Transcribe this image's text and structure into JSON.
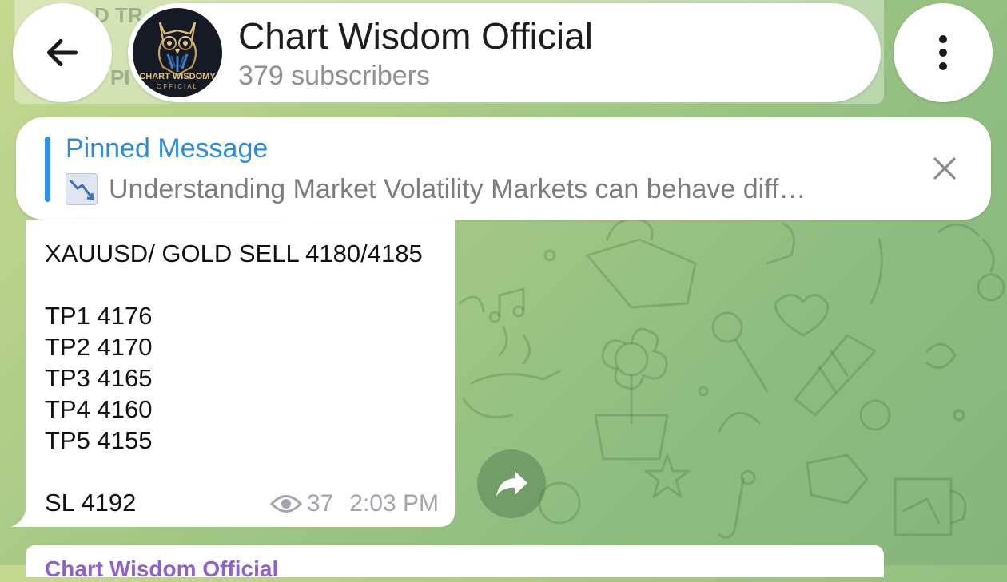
{
  "header": {
    "back_icon": "arrow-left-icon",
    "channel_name": "Chart Wisdom Official",
    "subscribers": "379 subscribers",
    "avatar_text_1": "CHART WISDOMY",
    "avatar_text_2": "OFFICIAL",
    "menu_icon": "more-vertical-icon"
  },
  "background_ghost": {
    "text_1": "D TR",
    "text_2": "PI"
  },
  "pinned": {
    "title": "Pinned Message",
    "preview_icon": "chart-decreasing-emoji",
    "preview_text": "Understanding Market Volatility  Markets can behave diff…",
    "close_icon": "close-icon"
  },
  "message": {
    "lines": [
      "XAUUSD/ GOLD SELL 4180/4185",
      "TP1 4176",
      "TP2 4170",
      "TP3 4165",
      "TP4 4160",
      "TP5 4155",
      "SL 4192"
    ],
    "views_icon": "eye-icon",
    "views": "37",
    "time": "2:03 PM",
    "share_icon": "share-arrow-icon"
  },
  "next_message": {
    "sender": "Chart Wisdom Official"
  },
  "colors": {
    "accent": "#2f8bd6",
    "sender_purple": "#9061c8",
    "wallpaper_start": "#c7d890",
    "wallpaper_end": "#86b47c"
  }
}
